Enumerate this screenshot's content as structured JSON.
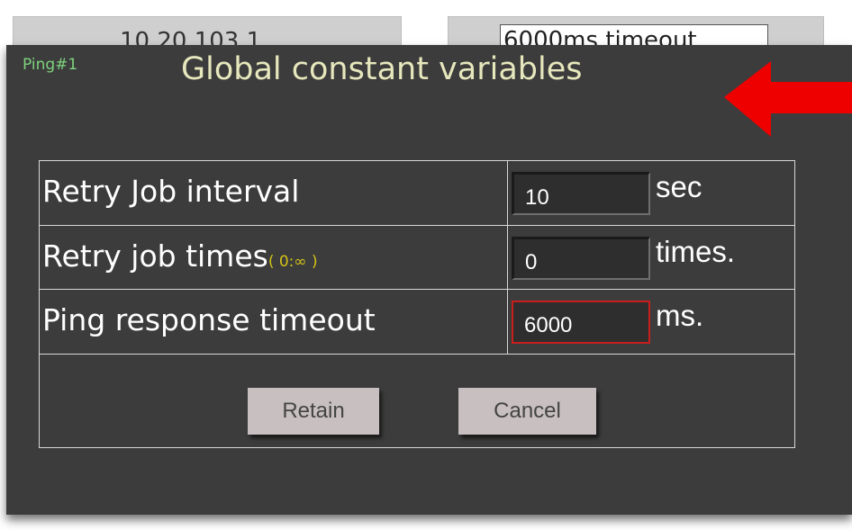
{
  "background": {
    "ip_cell_text": "10.20.103.1",
    "timeout_cell_value": "6000ms timeout"
  },
  "dialog": {
    "tag": "Ping#1",
    "title": "Global constant variables",
    "annotation_arrow_color": "#ee0000",
    "rows": [
      {
        "label": "Retry Job interval",
        "hint": "",
        "value": "10",
        "unit": "sec"
      },
      {
        "label": "Retry job times",
        "hint": "( 0:∞ )",
        "value": "0",
        "unit": "times."
      },
      {
        "label": "Ping response timeout",
        "hint": "",
        "value": "6000",
        "unit": "ms."
      }
    ],
    "buttons": {
      "retain": "Retain",
      "cancel": "Cancel"
    }
  }
}
